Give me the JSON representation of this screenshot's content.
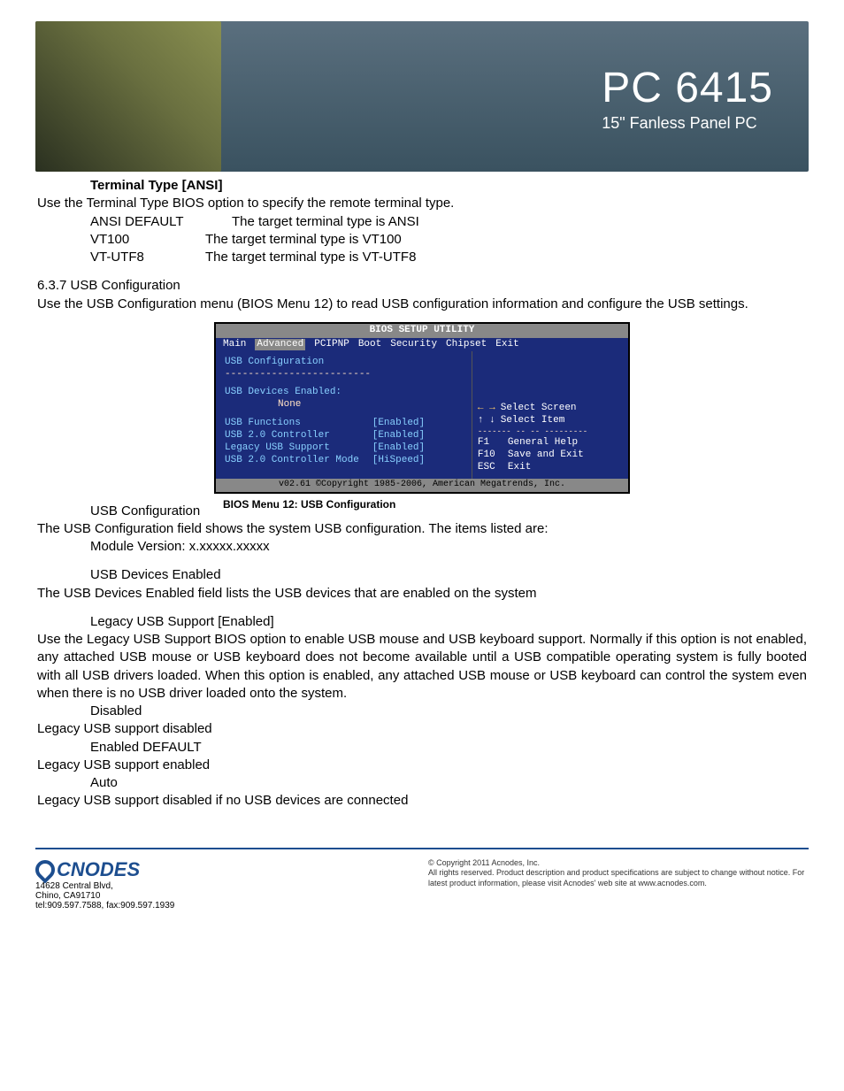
{
  "header": {
    "title": "PC 6415",
    "subtitle": "15\" Fanless Panel PC"
  },
  "terminal": {
    "heading": "Terminal Type [ANSI]",
    "intro": "Use the Terminal Type BIOS option to specify the remote terminal type.",
    "rows": [
      {
        "name": "ANSI  DEFAULT",
        "desc": "The target terminal type is ANSI"
      },
      {
        "name": "VT100",
        "desc": "The target terminal type is VT100"
      },
      {
        "name": "VT-UTF8",
        "desc": "The target terminal type is VT-UTF8"
      }
    ]
  },
  "usb": {
    "section_num": "6.3.7 USB Configuration",
    "intro": "Use the USB Configuration menu (BIOS Menu 12) to read USB configuration information and configure the USB settings.",
    "caption_left": "USB Configuration",
    "caption": "BIOS Menu 12: USB Configuration",
    "config_field_line": "The USB Configuration field shows the system USB configuration. The items listed are:",
    "module_version": "Module Version: x.xxxxx.xxxxx",
    "devices_enabled_heading": "USB Devices Enabled",
    "devices_enabled_text": "The USB Devices Enabled field lists the USB devices that are enabled on the system",
    "legacy_heading": "Legacy USB Support [Enabled]",
    "legacy_para": "Use the Legacy USB Support BIOS option to enable USB mouse and USB keyboard support. Normally if this option is not enabled, any attached USB mouse or USB keyboard does not become available until a USB compatible operating system is fully booted with all USB drivers loaded. When this option is enabled, any attached USB mouse or USB keyboard can control the system even when there is no USB driver loaded onto the system.",
    "options": [
      {
        "name": "Disabled",
        "desc": "Legacy USB support disabled"
      },
      {
        "name": "Enabled DEFAULT",
        "desc": "Legacy USB support enabled"
      },
      {
        "name": "Auto",
        "desc": "Legacy USB support disabled if no USB devices are connected"
      }
    ]
  },
  "bios": {
    "title": "BIOS SETUP UTILITY",
    "menu": [
      "Main",
      "Advanced",
      "PCIPNP",
      "Boot",
      "Security",
      "Chipset",
      "Exit"
    ],
    "active_menu_index": 1,
    "left_heading": "USB Configuration",
    "devices_label": "USB Devices Enabled:",
    "devices_value": "None",
    "items": [
      {
        "label": "USB Functions",
        "value": "[Enabled]"
      },
      {
        "label": "USB 2.0 Controller",
        "value": "[Enabled]"
      },
      {
        "label": "Legacy USB Support",
        "value": "[Enabled]"
      },
      {
        "label": "USB 2.0 Controller Mode",
        "value": "[HiSpeed]"
      }
    ],
    "help": {
      "select_screen": "Select Screen",
      "select_item": "Select Item",
      "lines": [
        {
          "key": "F1",
          "text": "General Help"
        },
        {
          "key": "F10",
          "text": "Save and Exit"
        },
        {
          "key": "ESC",
          "text": "Exit"
        }
      ]
    },
    "footer": "v02.61 ©Copyright 1985-2006, American Megatrends, Inc."
  },
  "footer": {
    "logo_text": "CNODES",
    "addr1": "14628 Central Blvd,",
    "addr2": "Chino, CA91710",
    "tel": "tel:909.597.7588, fax:909.597.1939",
    "copyright": "© Copyright 2011 Acnodes, Inc.",
    "line2": "All rights reserved. Product description and product specifications are subject to change without notice. For latest product information, please visit Acnodes' web site at www.acnodes.com."
  }
}
